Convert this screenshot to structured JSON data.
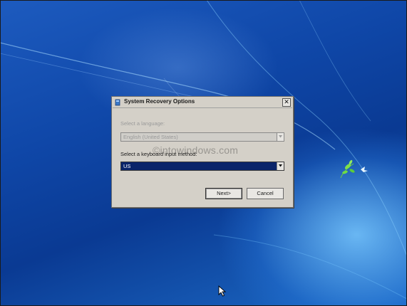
{
  "dialog": {
    "title": "System Recovery Options",
    "language_label": "Select a language:",
    "language_value": "English (United States)",
    "keyboard_label": "Select a keyboard input method:",
    "keyboard_value": "US",
    "next_button": "Next>",
    "cancel_button": "Cancel",
    "close_glyph": "✕"
  },
  "watermark": {
    "text": "©intowindows.com"
  },
  "colors": {
    "desktop_blue": "#0d3f9a",
    "dialog_gray": "#d4d0c8",
    "selection_navy": "#0a246a"
  }
}
